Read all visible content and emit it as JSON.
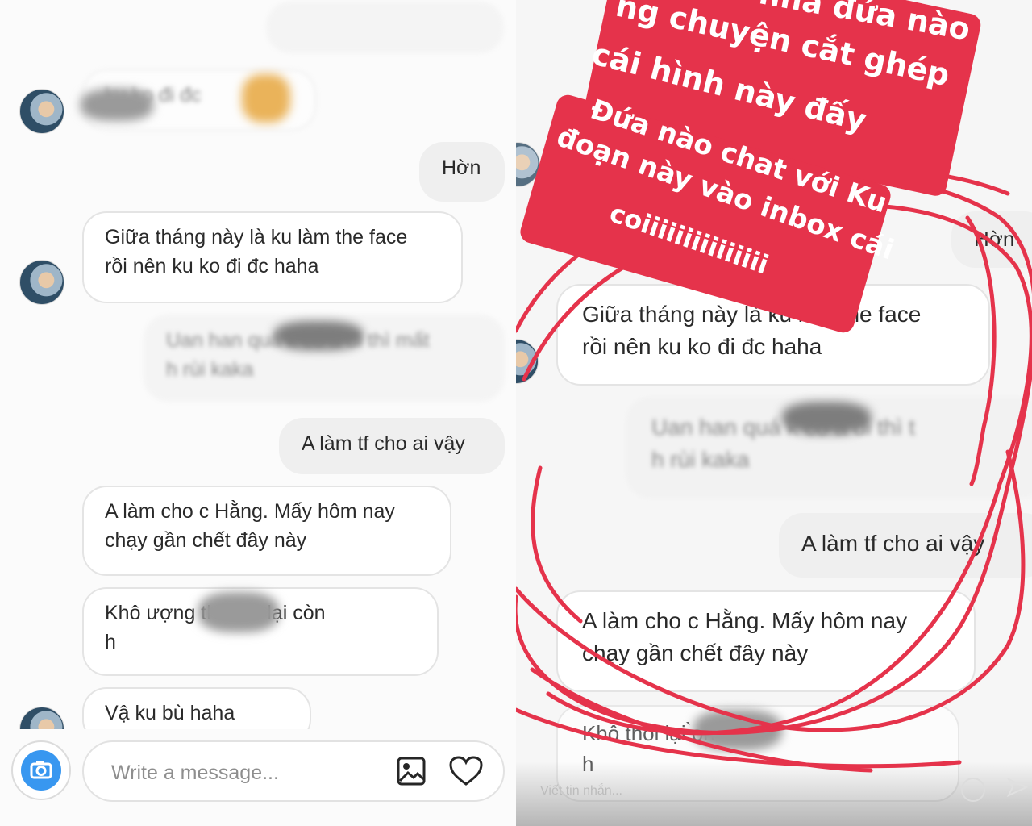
{
  "left_chat": {
    "messages": {
      "hon": "Hờn",
      "received_1": [
        "Giữa tháng này là ku làm the face",
        "rồi nên ku ko đi đc haha"
      ],
      "sent_blurred": [
        "Uan    han quá k cổ a đi thì mất",
        "h     rùi kaka"
      ],
      "sent_2": "A làm tf cho ai vậy",
      "received_2": [
        "A làm cho c Hằng. Mấy hôm nay",
        "chạy gần chết đây này"
      ],
      "received_3_blurred": [
        "Khô     ượng      thì thôi lại còn",
        "h"
      ],
      "received_4_partial": "Vậ    ku bù haha",
      "top_blurred": "   ku ko đi đc"
    },
    "composer": {
      "placeholder": "Write a message...",
      "camera_icon": "camera-icon",
      "gallery_icon": "image-icon",
      "like_icon": "heart-icon"
    }
  },
  "right_story": {
    "captions": [
      "nha đứa nào",
      "ng chuyện cắt ghép",
      "cái hình này đấy",
      "Đứa nào chat với Ku",
      "đoạn này vào inbox cái",
      "coiiiiiiiiiiiiiii"
    ],
    "messages": {
      "hon_partial": "Hờn",
      "received_1": [
        "Giữa tháng này là ku làm the face",
        "rồi nên ku ko đi đc haha"
      ],
      "sent_blurred": [
        "Uan    han quá k cổ a đi thì   t",
        "h     rùi kaka"
      ],
      "sent_2": "A làm tf cho ai vậy",
      "received_2": [
        "A làm cho c Hằng. Mấy hôm nay",
        "chạy gần chết đây này"
      ],
      "received_3_blurred": [
        "Khô              thôi lại   ̀on",
        "h"
      ]
    },
    "composer_placeholder": "Viết tin nhắn...",
    "accent_color": "#e5334b"
  }
}
